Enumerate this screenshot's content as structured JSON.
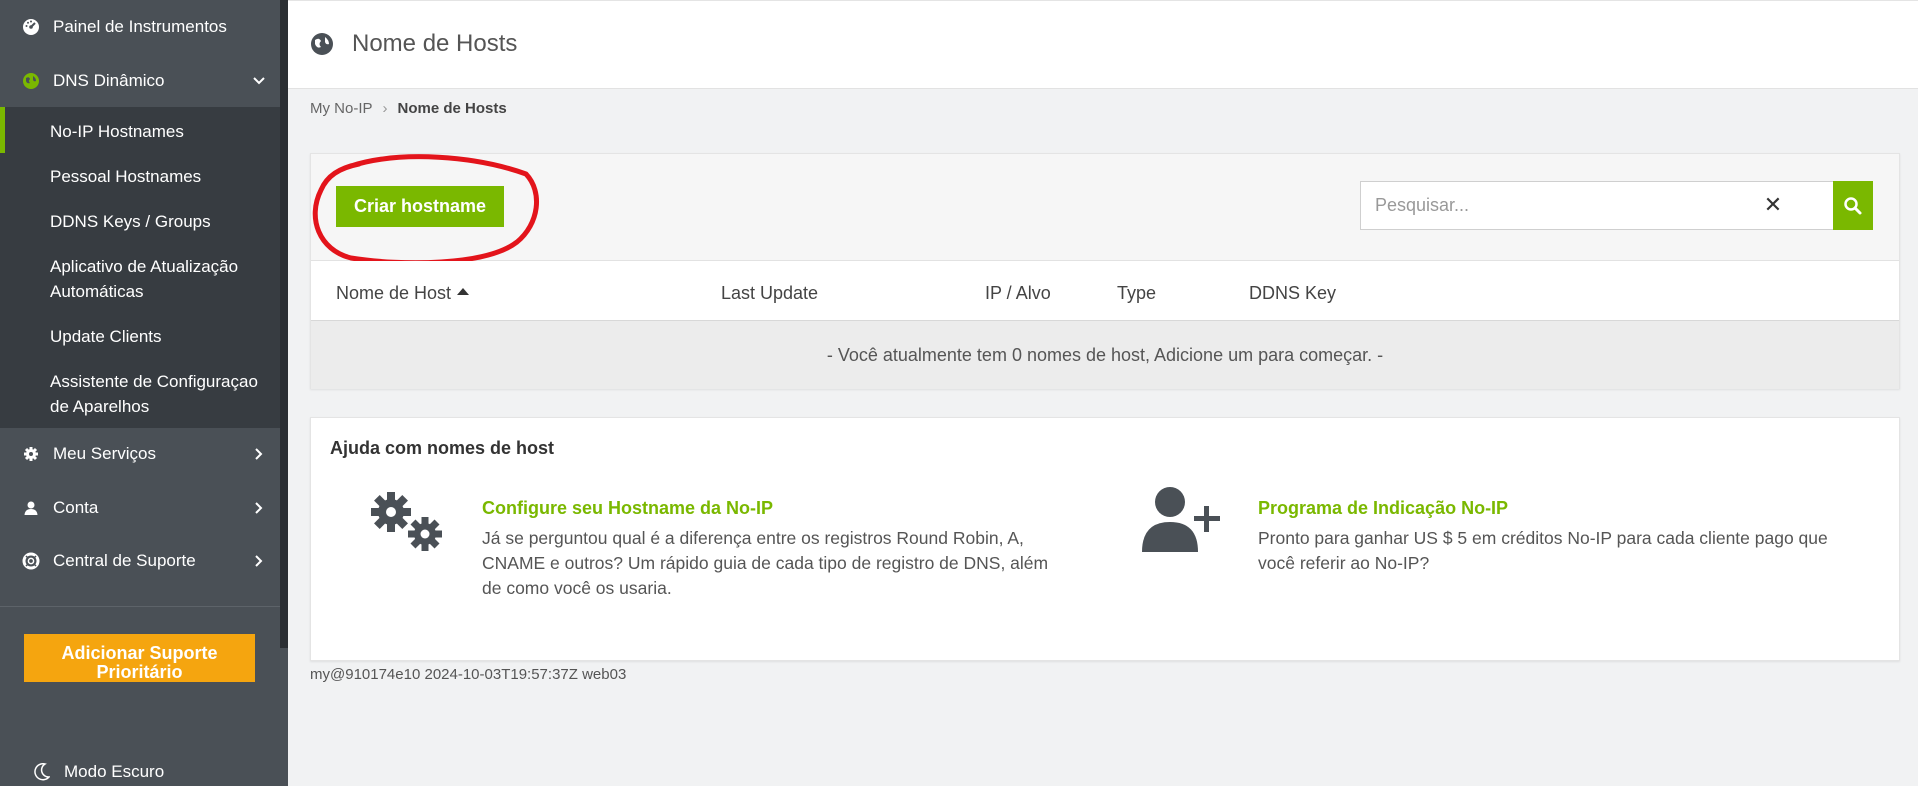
{
  "sidebar": {
    "items": [
      {
        "label": "Painel de Instrumentos",
        "icon": "dashboard-icon"
      },
      {
        "label": "DNS Dinâmico",
        "icon": "globe-icon"
      },
      {
        "label": "Meu Serviços",
        "icon": "gear-icon"
      },
      {
        "label": "Conta",
        "icon": "user-icon"
      },
      {
        "label": "Central de Suporte",
        "icon": "lifebuoy-icon"
      }
    ],
    "submenu": [
      {
        "label": "No-IP Hostnames"
      },
      {
        "label": "Pessoal Hostnames"
      },
      {
        "label": "DDNS Keys / Groups"
      },
      {
        "label": "Aplicativo de Atualização Automáticas"
      },
      {
        "label": "Update Clients"
      },
      {
        "label": "Assistente de Configuraçao de Aparelhos"
      }
    ],
    "priority_button": "Adicionar Suporte Prioritário",
    "dark_mode": "Modo Escuro"
  },
  "header": {
    "title": "Nome de Hosts"
  },
  "breadcrumb": {
    "root": "My No-IP",
    "current": "Nome de Hosts"
  },
  "toolbar": {
    "create_label": "Criar hostname",
    "search_placeholder": "Pesquisar...",
    "clear_symbol": "✕"
  },
  "table": {
    "columns": [
      "Nome de Host",
      "Last Update",
      "IP / Alvo",
      "Type",
      "DDNS Key"
    ],
    "empty_message": "- Você atualmente tem 0 nomes de host, Adicione um para começar. -"
  },
  "help": {
    "title": "Ajuda com nomes de host",
    "cards": [
      {
        "title": "Configure seu Hostname da No-IP",
        "description": "Já se perguntou qual é a diferença entre os registros Round Robin, A, CNAME e outros? Um rápido guia de cada tipo de registro de DNS, além de como você os usaria.",
        "icon": "gears-icon"
      },
      {
        "title": "Programa de Indicação No-IP",
        "description": "Pronto para ganhar US $ 5 em créditos No-IP para cada cliente pago que você referir ao No-IP?",
        "icon": "add-user-icon"
      }
    ]
  },
  "footer": {
    "build": "my@910174e10 2024-10-03T19:57:37Z web03"
  },
  "colors": {
    "accent": "#7ab800",
    "sidebar": "#4a5056",
    "submenu": "#373c41",
    "priority": "#f5a50f",
    "annotation": "#e3141b"
  }
}
